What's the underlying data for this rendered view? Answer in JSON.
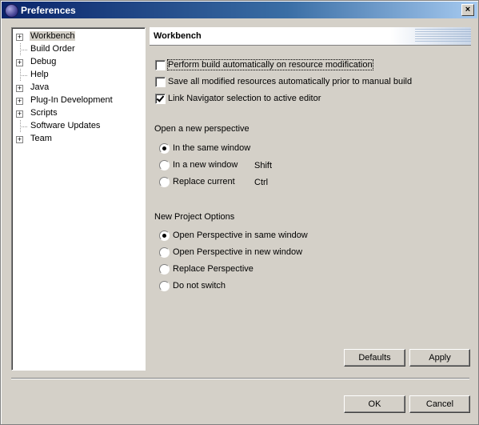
{
  "window": {
    "title": "Preferences",
    "close_glyph": "×"
  },
  "tree": {
    "items": [
      {
        "label": "Workbench",
        "expandable": true,
        "selected": true
      },
      {
        "label": "Build Order",
        "expandable": false
      },
      {
        "label": "Debug",
        "expandable": true
      },
      {
        "label": "Help",
        "expandable": false
      },
      {
        "label": "Java",
        "expandable": true
      },
      {
        "label": "Plug-In Development",
        "expandable": true
      },
      {
        "label": "Scripts",
        "expandable": true
      },
      {
        "label": "Software Updates",
        "expandable": false
      },
      {
        "label": "Team",
        "expandable": true
      }
    ],
    "expander_glyph": "+"
  },
  "page": {
    "title": "Workbench",
    "checkboxes": [
      {
        "label": "Perform build automatically on resource modification",
        "checked": false
      },
      {
        "label": "Save all modified resources automatically prior to manual build",
        "checked": false
      },
      {
        "label": "Link Navigator selection to active editor",
        "checked": true
      }
    ],
    "perspective_group": {
      "title": "Open a new perspective",
      "options": [
        {
          "label": "In the same window",
          "checked": true,
          "shortcut": ""
        },
        {
          "label": "In a new window",
          "checked": false,
          "shortcut": "Shift"
        },
        {
          "label": "Replace current",
          "checked": false,
          "shortcut": "Ctrl"
        }
      ]
    },
    "project_group": {
      "title": "New Project Options",
      "options": [
        {
          "label": "Open Perspective in same window",
          "checked": true
        },
        {
          "label": "Open Perspective in new window",
          "checked": false
        },
        {
          "label": "Replace Perspective",
          "checked": false
        },
        {
          "label": "Do not switch",
          "checked": false
        }
      ]
    },
    "defaults_label": "Defaults",
    "apply_label": "Apply"
  },
  "footer": {
    "ok_label": "OK",
    "cancel_label": "Cancel"
  }
}
